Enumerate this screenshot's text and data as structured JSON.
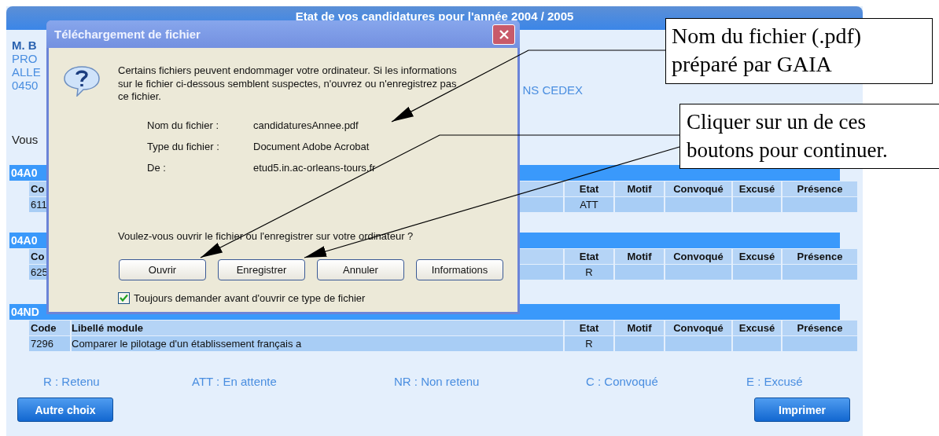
{
  "page": {
    "title": "Etat de vos candidatures pour l'année 2004 / 2005",
    "address_lines": [
      {
        "text": "M. B",
        "kind": "name"
      },
      {
        "text": "PRO",
        "kind": "plain"
      },
      {
        "text": "ALLE",
        "kind": "plain"
      },
      {
        "text": "0450",
        "kind": "plain",
        "tail": "NS CEDEX"
      }
    ],
    "intro": "Vous",
    "sections": [
      {
        "heading": "04A0",
        "columns": [
          {
            "label": "Co",
            "kind": "code"
          },
          {
            "label": "Etat",
            "kind": "data"
          },
          {
            "label": "Motif",
            "kind": "data"
          },
          {
            "label": "Convoqué",
            "kind": "data"
          },
          {
            "label": "Excusé",
            "kind": "data"
          },
          {
            "label": "Présence",
            "kind": "data"
          }
        ],
        "rows": [
          {
            "cells": [
              "611",
              "ATT"
            ]
          }
        ]
      },
      {
        "heading": "04A0",
        "columns": [
          {
            "label": "Co",
            "kind": "code"
          },
          {
            "label": "Etat",
            "kind": "data"
          },
          {
            "label": "Motif",
            "kind": "data"
          },
          {
            "label": "Convoqué",
            "kind": "data"
          },
          {
            "label": "Excusé",
            "kind": "data"
          },
          {
            "label": "Présence",
            "kind": "data"
          }
        ],
        "rows": [
          {
            "cells": [
              "625",
              "R"
            ]
          }
        ]
      },
      {
        "heading": "04ND",
        "columns": [
          {
            "label": "Code",
            "kind": "code"
          },
          {
            "label": "Libellé module",
            "kind": "title"
          },
          {
            "label": "Etat",
            "kind": "data"
          },
          {
            "label": "Motif",
            "kind": "data"
          },
          {
            "label": "Convoqué",
            "kind": "data"
          },
          {
            "label": "Excusé",
            "kind": "data"
          },
          {
            "label": "Présence",
            "kind": "data"
          }
        ],
        "rows": [
          {
            "cells": [
              "7296",
              "Comparer le pilotage d'un établissement français a",
              "R"
            ]
          }
        ]
      }
    ],
    "legend": [
      "R : Retenu",
      "ATT : En attente",
      "NR : Non retenu",
      "C : Convoqué",
      "E : Excusé"
    ],
    "buttons": [
      "Autre choix",
      "Imprimer"
    ]
  },
  "dialog": {
    "title": "Téléchargement de fichier",
    "message": "Certains fichiers peuvent endommager votre ordinateur. Si les informations sur le fichier ci-dessous semblent suspectes, n'ouvrez ou n'enregistrez pas ce fichier.",
    "fields": [
      {
        "label": "Nom du fichier :",
        "value": "candidaturesAnnee.pdf"
      },
      {
        "label": "Type du fichier :",
        "value": "Document Adobe Acrobat"
      },
      {
        "label": "De :",
        "value": "etud5.in.ac-orleans-tours.fr"
      }
    ],
    "question": "Voulez-vous ouvrir le fichier ou l'enregistrer sur votre ordinateur ?",
    "buttons": [
      "Ouvrir",
      "Enregistrer",
      "Annuler",
      "Informations"
    ],
    "checkbox": {
      "label": "Toujours demander avant d'ouvrir ce type de fichier",
      "checked": true
    }
  },
  "callouts": [
    {
      "text": "Nom du fichier (.pdf) préparé par GAIA"
    },
    {
      "text": "Cliquer sur un de ces boutons pour continuer."
    }
  ]
}
